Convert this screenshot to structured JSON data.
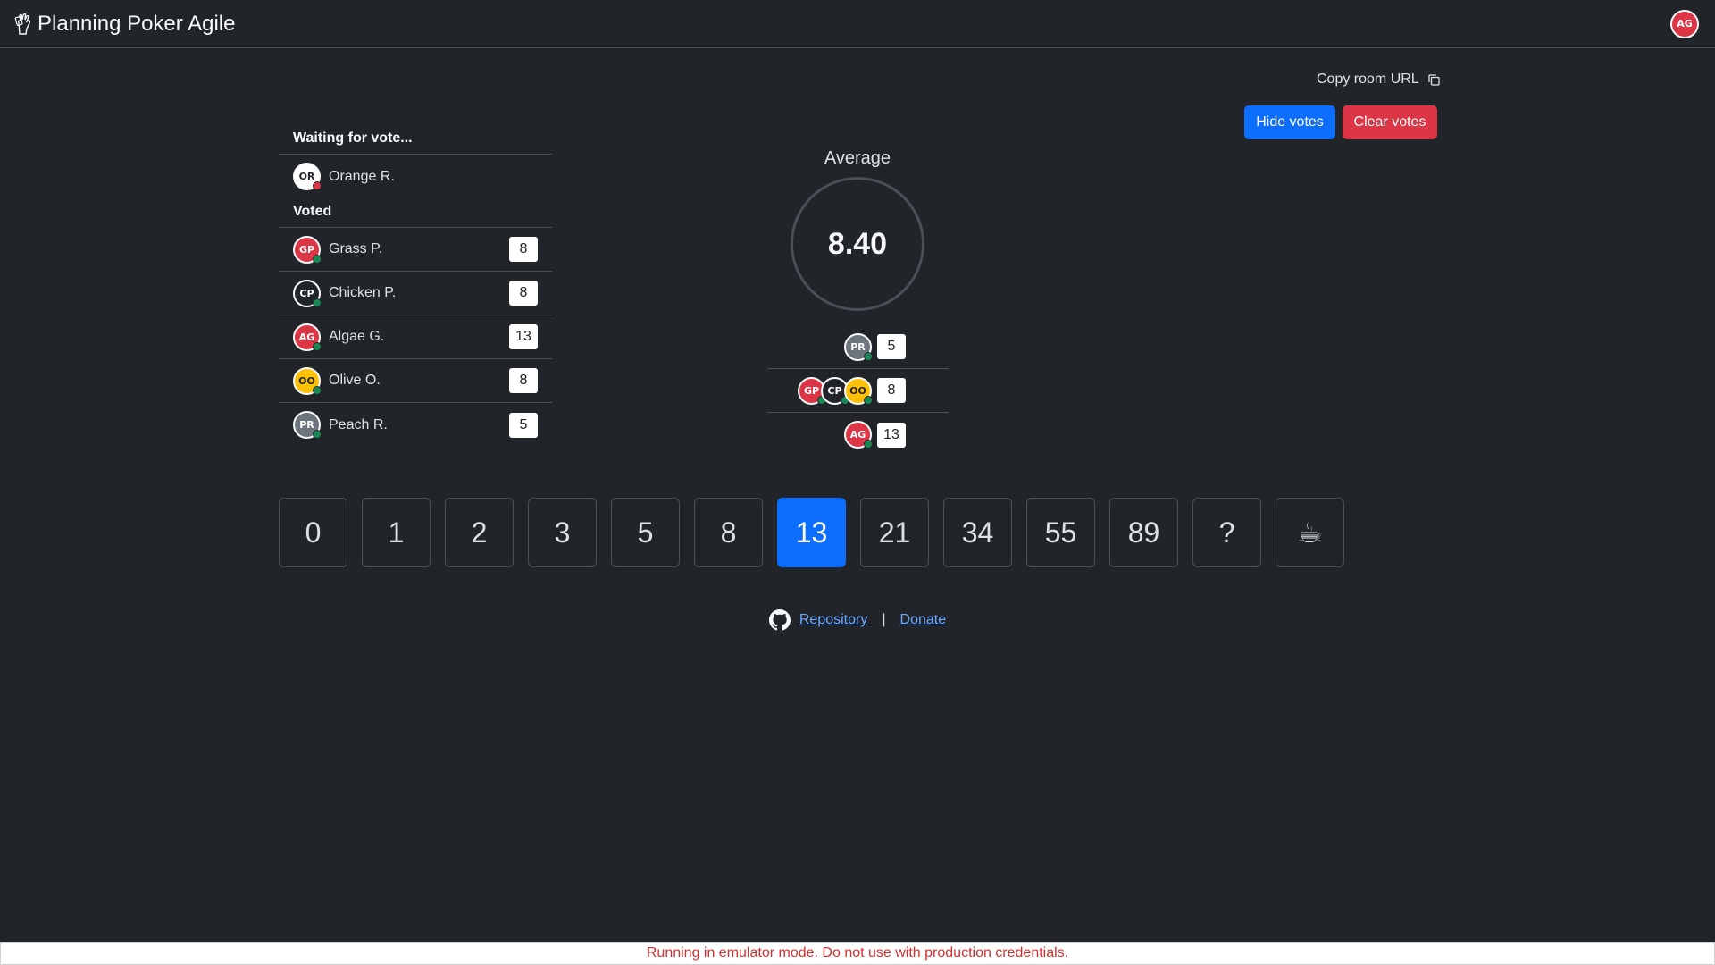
{
  "header": {
    "title": "Planning Poker Agile",
    "user_initials": "AG"
  },
  "toolbar": {
    "copy_url_label": "Copy room URL",
    "hide_votes_label": "Hide votes",
    "clear_votes_label": "Clear votes"
  },
  "waiting": {
    "heading": "Waiting for vote...",
    "players": [
      {
        "initials": "OR",
        "name": "Orange R."
      }
    ]
  },
  "voted": {
    "heading": "Voted",
    "players": [
      {
        "initials": "GP",
        "name": "Grass P.",
        "vote": "8"
      },
      {
        "initials": "CP",
        "name": "Chicken P.",
        "vote": "8"
      },
      {
        "initials": "AG",
        "name": "Algae G.",
        "vote": "13"
      },
      {
        "initials": "OO",
        "name": "Olive O.",
        "vote": "8"
      },
      {
        "initials": "PR",
        "name": "Peach R.",
        "vote": "5"
      }
    ]
  },
  "summary": {
    "average_label": "Average",
    "average_value": "8.40",
    "groups": [
      {
        "vote": "5",
        "initials": [
          "PR"
        ]
      },
      {
        "vote": "8",
        "initials": [
          "GP",
          "CP",
          "OO"
        ]
      },
      {
        "vote": "13",
        "initials": [
          "AG"
        ]
      }
    ]
  },
  "cards": [
    "0",
    "1",
    "2",
    "3",
    "5",
    "8",
    "13",
    "21",
    "34",
    "55",
    "89",
    "?",
    "☕"
  ],
  "selected_card": "13",
  "footer": {
    "repository_label": "Repository",
    "separator": "|",
    "donate_label": "Donate"
  },
  "emulator_banner": "Running in emulator mode. Do not use with production credentials.",
  "colors": {
    "primary": "#0d6efd",
    "danger": "#dc3545",
    "warning": "#ffc107",
    "secondary": "#6c757d",
    "background": "#212529"
  }
}
